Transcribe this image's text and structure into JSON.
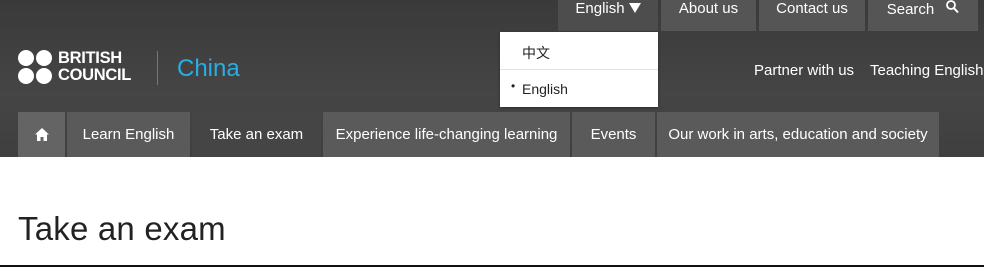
{
  "utility_nav": {
    "language_label": "English",
    "about_label": "About us",
    "contact_label": "Contact us",
    "search_label": "Search"
  },
  "brand": {
    "logo_line1": "BRITISH",
    "logo_line2": "COUNCIL",
    "country": "China"
  },
  "secondary_nav": {
    "partner_label": "Partner with us",
    "teaching_label": "Teaching English"
  },
  "main_nav": {
    "items": [
      {
        "label": "Learn English"
      },
      {
        "label": "Take an exam"
      },
      {
        "label": "Experience life-changing learning"
      },
      {
        "label": "Events"
      },
      {
        "label": "Our work in arts, education and society"
      }
    ]
  },
  "language_dropdown": {
    "options": [
      {
        "label": "中文"
      },
      {
        "label": "English"
      }
    ],
    "bullet": "•"
  },
  "page": {
    "title": "Take an exam"
  },
  "colors": {
    "header_bg": "#3f3f3f",
    "nav_item_bg": "#5a5a5a",
    "nav_active_bg": "#454545",
    "country_accent": "#29aee3"
  }
}
